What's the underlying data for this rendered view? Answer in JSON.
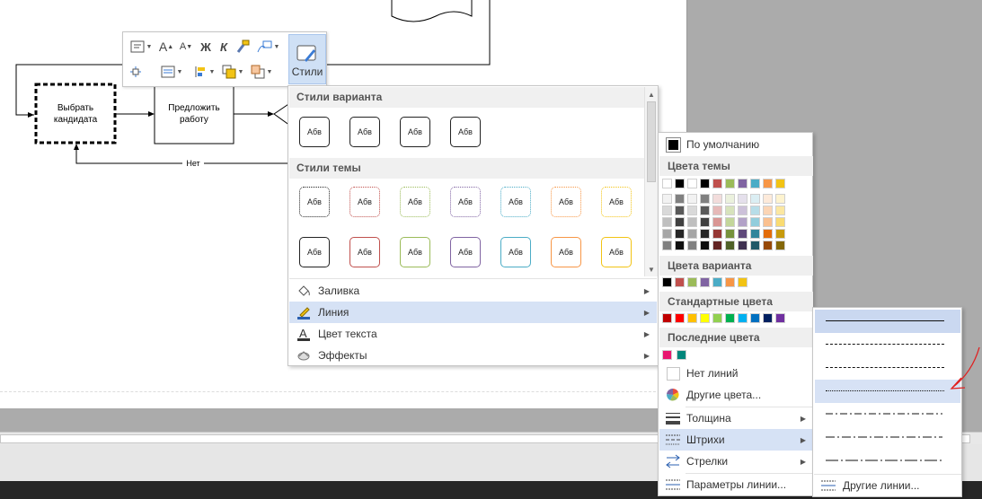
{
  "diagram": {
    "shape1": "Выбрать кандидата",
    "shape2": "Предложить работу",
    "connector_label": "Нет"
  },
  "mini_toolbar": {
    "font_grow": "A",
    "font_shrink": "A",
    "bold": "Ж",
    "italic": "К",
    "styles_label": "Стили"
  },
  "styles_gallery": {
    "variant_header": "Стили варианта",
    "theme_header": "Стили темы",
    "sample_text": "Абв",
    "variant_styles": [
      {
        "border": "#222222"
      },
      {
        "border": "#222222"
      },
      {
        "border": "#222222"
      },
      {
        "border": "#222222"
      }
    ],
    "theme_row1": [
      {
        "border": "#222222"
      },
      {
        "border": "#c0504d"
      },
      {
        "border": "#9bbb59"
      },
      {
        "border": "#8064a2"
      },
      {
        "border": "#4bacc6"
      },
      {
        "border": "#f79646"
      },
      {
        "border": "#f2c314"
      }
    ],
    "theme_row2": [
      {
        "border": "#222222"
      },
      {
        "border": "#c0504d"
      },
      {
        "border": "#9bbb59"
      },
      {
        "border": "#8064a2"
      },
      {
        "border": "#4bacc6"
      },
      {
        "border": "#f79646"
      },
      {
        "border": "#f2c314"
      }
    ],
    "menu": [
      {
        "label": "Заливка",
        "icon": "paint-bucket-icon"
      },
      {
        "label": "Линия",
        "icon": "pen-line-icon"
      },
      {
        "label": "Цвет текста",
        "icon": "text-color-icon"
      },
      {
        "label": "Эффекты",
        "icon": "effects-icon"
      }
    ]
  },
  "color_menu": {
    "default_label": "По умолчанию",
    "theme_colors_header": "Цвета темы",
    "variant_colors_header": "Цвета варианта",
    "standard_colors_header": "Стандартные цвета",
    "recent_colors_header": "Последние цвета",
    "no_lines_label": "Нет линий",
    "more_colors_label": "Другие цвета...",
    "weight_label": "Толщина",
    "dashes_label": "Штрихи",
    "arrows_label": "Стрелки",
    "line_options_label": "Параметры линии...",
    "theme_top": [
      "#ffffff",
      "#000000",
      "#ffffff",
      "#000000",
      "#c0504d",
      "#9bbb59",
      "#8064a2",
      "#4bacc6",
      "#f79646",
      "#f2c314"
    ],
    "theme_shades": [
      [
        "#f2f2f2",
        "#d9d9d9",
        "#bfbfbf",
        "#a6a6a6",
        "#808080"
      ],
      [
        "#808080",
        "#595959",
        "#404040",
        "#262626",
        "#0d0d0d"
      ],
      [
        "#f2f2f2",
        "#d9d9d9",
        "#bfbfbf",
        "#a6a6a6",
        "#808080"
      ],
      [
        "#808080",
        "#595959",
        "#404040",
        "#262626",
        "#0d0d0d"
      ],
      [
        "#f2dcdb",
        "#e6b9b8",
        "#d99694",
        "#953734",
        "#632423"
      ],
      [
        "#ebf1dd",
        "#d7e3bc",
        "#c3d69b",
        "#76923c",
        "#4f6128"
      ],
      [
        "#e5e0ec",
        "#ccc1d9",
        "#b2a2c7",
        "#5f497a",
        "#3f3151"
      ],
      [
        "#dbeef3",
        "#b7dde8",
        "#92cddc",
        "#31859b",
        "#205867"
      ],
      [
        "#fdeada",
        "#fbd5b5",
        "#fac08f",
        "#e36c09",
        "#974806"
      ],
      [
        "#fdf3cf",
        "#fbe7a1",
        "#f9db72",
        "#c79a0c",
        "#846708"
      ]
    ],
    "variant_colors": [
      "#000000",
      "#c0504d",
      "#9bbb59",
      "#8064a2",
      "#4bacc6",
      "#f79646",
      "#f2c314"
    ],
    "standard_colors": [
      "#c00000",
      "#ff0000",
      "#ffc000",
      "#ffff00",
      "#92d050",
      "#00b050",
      "#00b0f0",
      "#0070c0",
      "#002060",
      "#7030a0"
    ],
    "recent_colors": [
      "#e8176f",
      "#00857a"
    ]
  },
  "dash_menu": {
    "more_label": "Другие линии...",
    "annotation_color": "#e02020"
  }
}
